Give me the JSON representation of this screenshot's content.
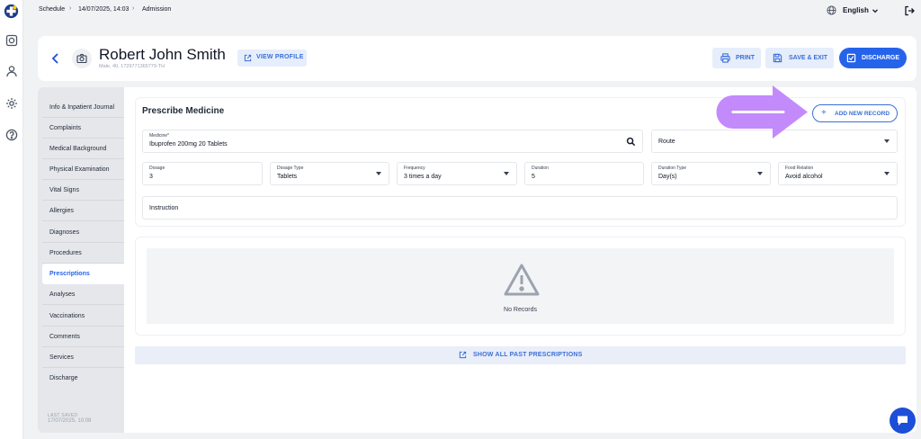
{
  "app": {
    "icons": [
      "app-logo-icon",
      "monitor-icon",
      "user-icon",
      "gear-icon",
      "help-icon",
      "globe-icon",
      "logout-icon",
      "chat-icon"
    ],
    "accent_color": "#2563eb"
  },
  "breadcrumb": {
    "items": [
      "Schedule",
      "14/07/2025, 14:03",
      "Admission"
    ],
    "separator": "›"
  },
  "language": {
    "label": "English"
  },
  "patient": {
    "name": "Robert John Smith",
    "meta": "Male, 40, 1729771365779-TH",
    "view_profile_label": "VIEW PROFILE"
  },
  "actions": {
    "print_label": "PRINT",
    "save_exit_label": "SAVE & EXIT",
    "discharge_label": "DISCHARGE"
  },
  "sections": {
    "items": [
      {
        "label": "Info & Inpatient Journal"
      },
      {
        "label": "Complaints"
      },
      {
        "label": "Medical Background"
      },
      {
        "label": "Physical Examination"
      },
      {
        "label": "Vital Signs"
      },
      {
        "label": "Allergies"
      },
      {
        "label": "Diagnoses"
      },
      {
        "label": "Procedures"
      },
      {
        "label": "Prescriptions",
        "active": true
      },
      {
        "label": "Analyses"
      },
      {
        "label": "Vaccinations"
      },
      {
        "label": "Comments"
      },
      {
        "label": "Services"
      },
      {
        "label": "Discharge"
      }
    ],
    "last_saved_label": "LAST SAVED",
    "last_saved_time": "17/07/2025, 10:08"
  },
  "prescribe": {
    "title": "Prescribe Medicine",
    "add_label": "ADD NEW RECORD",
    "medicine": {
      "label": "Medicine*",
      "value": "Ibuprofen 200mg 20 Tablets"
    },
    "route": {
      "value": "Route"
    },
    "dosage": {
      "label": "Dosage",
      "value": "3"
    },
    "dosage_type": {
      "label": "Dosage Type",
      "value": "Tablets"
    },
    "frequency": {
      "label": "Frequency",
      "value": "3 times a day"
    },
    "duration": {
      "label": "Duration",
      "value": "5"
    },
    "duration_type": {
      "label": "Duration Type",
      "value": "Day(s)"
    },
    "food_relation": {
      "label": "Food Relation",
      "value": "Avoid alcohol"
    },
    "instruction": {
      "placeholder": "Instruction"
    }
  },
  "records": {
    "empty_text": "No Records"
  },
  "show_past_label": "SHOW ALL PAST PRESCRIPTIONS",
  "callout": {
    "color": "#c084fc"
  }
}
